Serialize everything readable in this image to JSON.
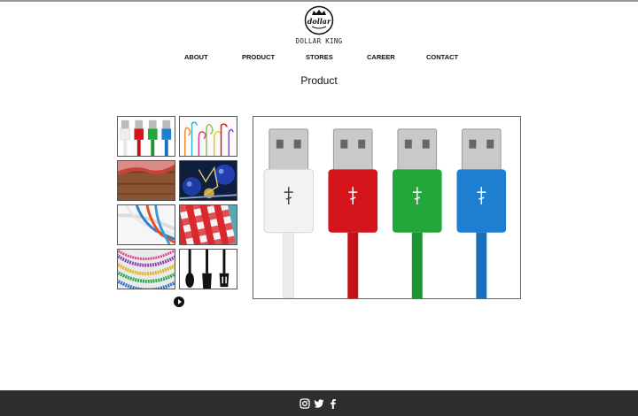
{
  "brand": {
    "name": "DOLLAR KING",
    "badge_text": "dollar"
  },
  "nav": {
    "items": [
      {
        "label": "ABOUT"
      },
      {
        "label": "PRODUCT"
      },
      {
        "label": "STORES"
      },
      {
        "label": "CAREER"
      },
      {
        "label": "CONTACT"
      }
    ]
  },
  "page": {
    "title": "Product"
  },
  "gallery": {
    "thumbnails": [
      {
        "subject": "usb-cables"
      },
      {
        "subject": "party-straws"
      },
      {
        "subject": "checkered-tablecloth-on-wood"
      },
      {
        "subject": "christmas-ornaments"
      },
      {
        "subject": "network-cables"
      },
      {
        "subject": "red-white-gingham"
      },
      {
        "subject": "mardi-gras-beads"
      },
      {
        "subject": "black-kitchen-utensils"
      }
    ],
    "play_icon": "play-icon",
    "main_image_subject": "usb-cables",
    "cable_colors": [
      "#f2f2f2",
      "#d4151b",
      "#22a83a",
      "#1e7fd0"
    ]
  },
  "footer": {
    "social_icons": [
      "instagram-icon",
      "twitter-icon",
      "facebook-icon"
    ]
  }
}
